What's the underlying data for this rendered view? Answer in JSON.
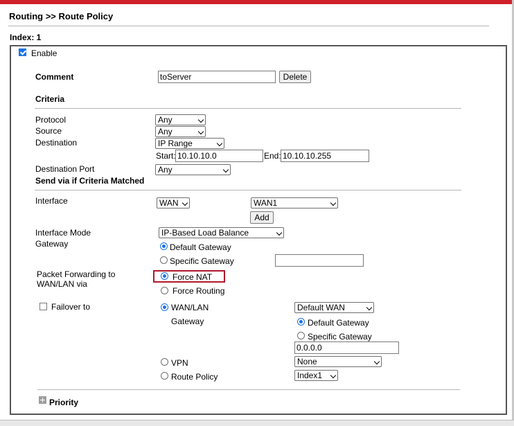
{
  "header": {
    "title": "Routing >> Route Policy",
    "index_label": "Index: 1"
  },
  "enable": {
    "label": "Enable",
    "checked": true
  },
  "comment": {
    "label": "Comment",
    "value": "toServer",
    "delete_label": "Delete"
  },
  "criteria": {
    "heading": "Criteria",
    "protocol": {
      "label": "Protocol",
      "value": "Any"
    },
    "source": {
      "label": "Source",
      "value": "Any"
    },
    "destination": {
      "label": "Destination",
      "value": "IP Range",
      "start_label": "Start:",
      "start_value": "10.10.10.0",
      "end_label": "End:",
      "end_value": "10.10.10.255"
    },
    "destination_port": {
      "label": "Destination Port",
      "value": "Any"
    }
  },
  "send_via": {
    "heading": "Send via if Criteria Matched",
    "interface": {
      "label": "Interface",
      "type_value": "WAN",
      "port_value": "WAN1",
      "add_label": "Add"
    },
    "interface_mode": {
      "label": "Interface Mode",
      "value": "IP-Based Load Balance"
    },
    "gateway": {
      "label": "Gateway",
      "default_label": "Default Gateway",
      "specific_label": "Specific Gateway",
      "specific_value": ""
    },
    "packet_forwarding": {
      "label_line1": "Packet Forwarding to",
      "label_line2": "WAN/LAN via",
      "force_nat_label": "Force NAT",
      "force_routing_label": "Force Routing"
    },
    "failover": {
      "label": "Failover to",
      "checked": false,
      "wanlan_label": "WAN/LAN",
      "wanlan_sub_label": "Gateway",
      "wanlan_select_value": "Default WAN",
      "default_gateway_label": "Default Gateway",
      "specific_gateway_label": "Specific Gateway",
      "specific_gateway_value": "0.0.0.0",
      "vpn_label": "VPN",
      "vpn_select_value": "None",
      "route_policy_label": "Route Policy",
      "route_policy_select_value": "Index1"
    }
  },
  "priority": {
    "label": "Priority"
  },
  "colors": {
    "top_bar": "#d0202a",
    "highlight_border": "#b0182a",
    "accent": "#1a73e8"
  }
}
